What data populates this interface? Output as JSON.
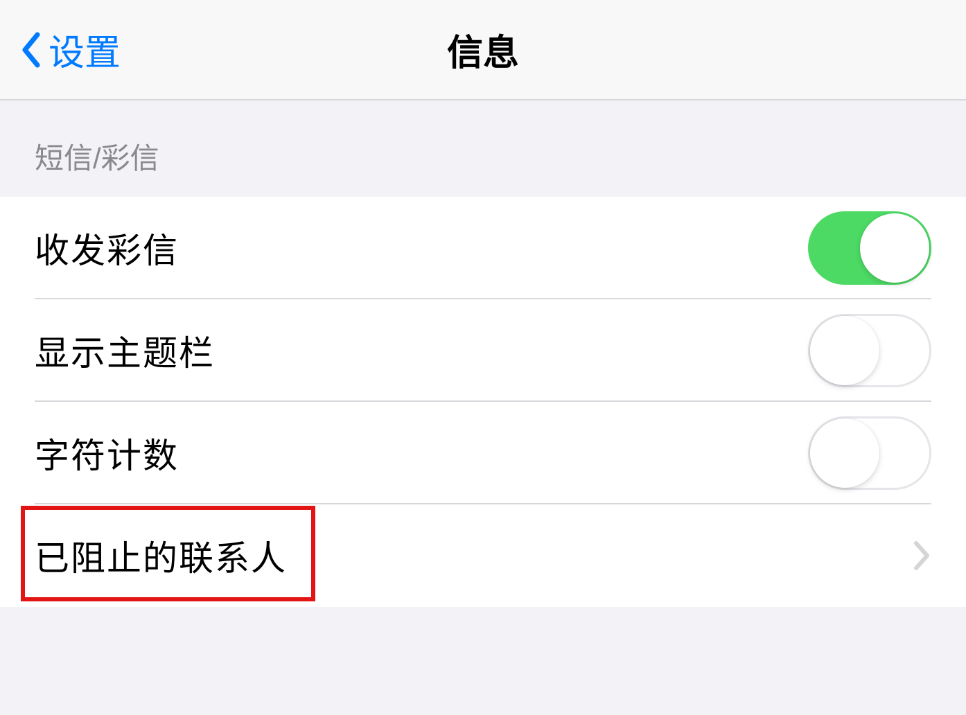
{
  "navbar": {
    "back_label": "设置",
    "title": "信息"
  },
  "section": {
    "header": "短信/彩信"
  },
  "rows": {
    "mms": {
      "label": "收发彩信",
      "toggle_on": true
    },
    "subject": {
      "label": "显示主题栏",
      "toggle_on": false
    },
    "charcount": {
      "label": "字符计数",
      "toggle_on": false
    },
    "blocked": {
      "label": "已阻止的联系人"
    }
  },
  "colors": {
    "accent_blue": "#007aff",
    "toggle_green": "#4cd964",
    "highlight_red": "#e31414"
  }
}
